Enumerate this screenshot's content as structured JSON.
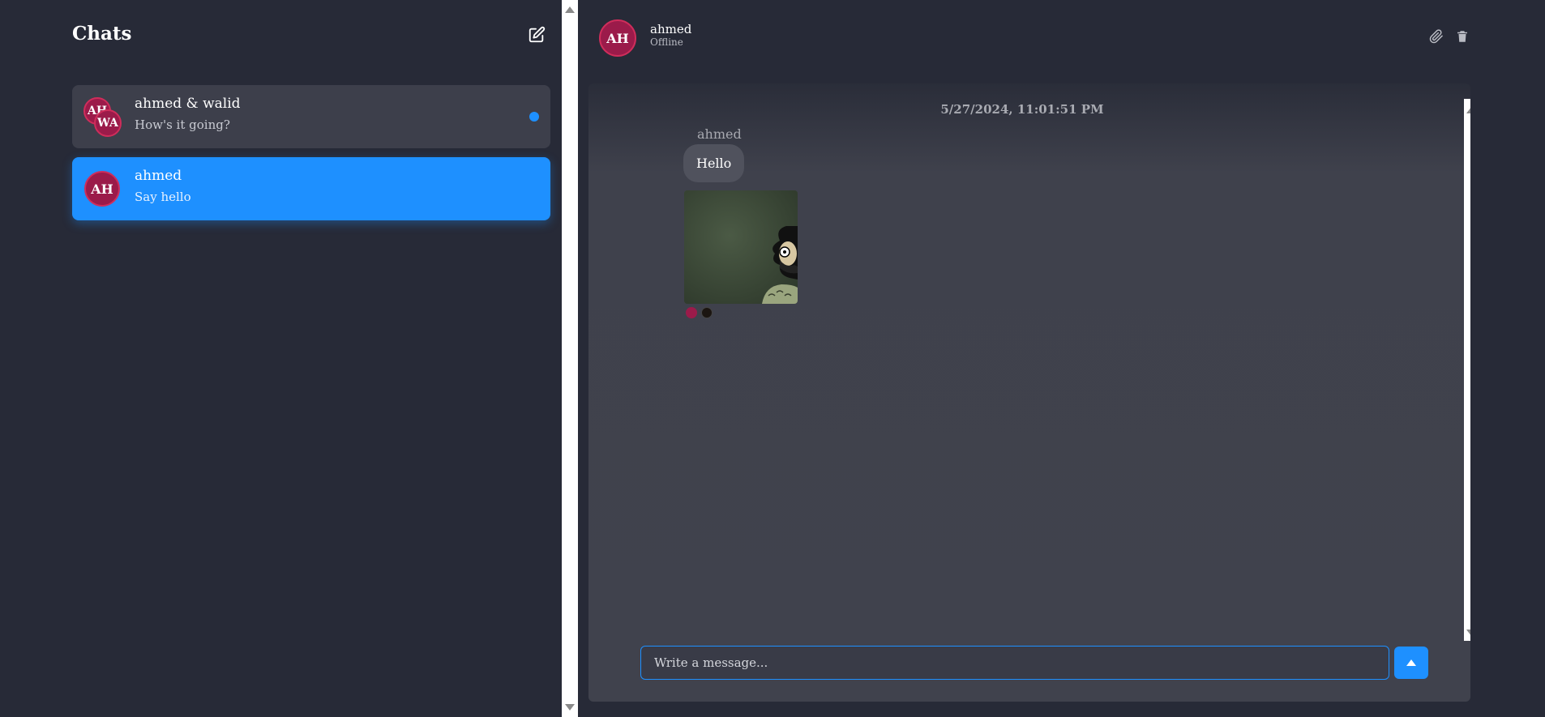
{
  "sidebar": {
    "title": "Chats",
    "chats": [
      {
        "name": "ahmed & walid",
        "preview": "How's it going?",
        "avatars": [
          "AH",
          "WA"
        ],
        "unread": true
      },
      {
        "name": "ahmed",
        "preview": "Say hello",
        "avatars": [
          "AH"
        ],
        "active": true
      }
    ]
  },
  "conversation": {
    "contact_name": "ahmed",
    "contact_initials": "AH",
    "contact_status": "Offline",
    "messages": [
      {
        "timestamp": "5/27/2024, 11:01:51 PM",
        "sender": "ahmed",
        "text": "Hello",
        "has_image": true
      }
    ],
    "composer_placeholder": "Write a message..."
  },
  "colors": {
    "background": "#272a37",
    "accent": "#1e90ff",
    "avatar": "#9b1b4a",
    "bubble": "#50525d"
  },
  "icons": [
    "compose-icon",
    "paperclip-icon",
    "trash-icon",
    "send-arrow-icon"
  ]
}
